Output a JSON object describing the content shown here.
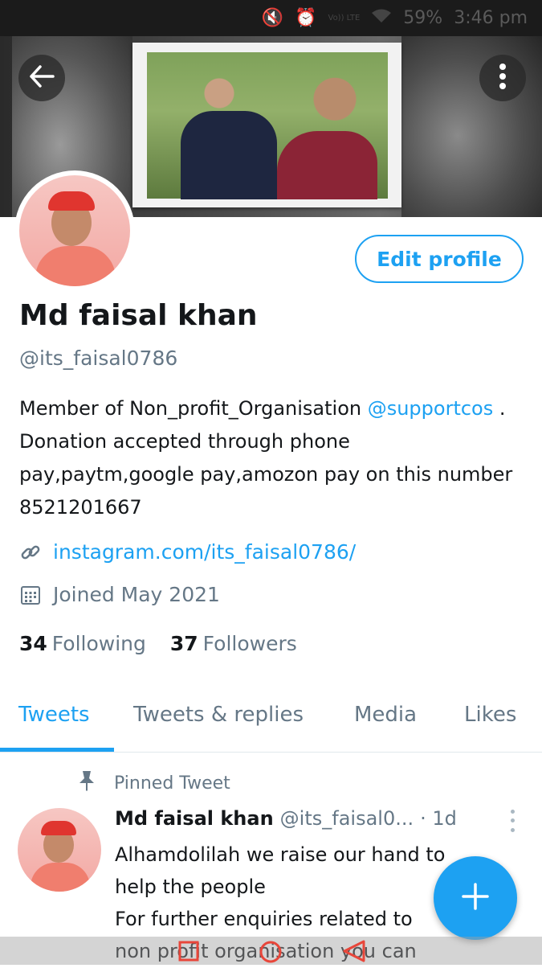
{
  "status_bar": {
    "battery": "59%",
    "time": "3:46 pm",
    "network": "Vo)) LTE"
  },
  "profile": {
    "name": "Md faisal khan",
    "handle": "@its_faisal0786",
    "edit_label": "Edit profile",
    "bio_before": "Member of Non_profit_Organisation ",
    "bio_mention": "@supportcos",
    "bio_after": " . Donation accepted through phone pay,paytm,google pay,amozon pay on this number 8521201667",
    "link": "instagram.com/its_faisal0786/",
    "joined": "Joined May 2021",
    "following_count": "34",
    "following_label": "Following",
    "followers_count": "37",
    "followers_label": "Followers"
  },
  "tabs": [
    {
      "label": "Tweets",
      "active": true
    },
    {
      "label": "Tweets & replies",
      "active": false
    },
    {
      "label": "Media",
      "active": false
    },
    {
      "label": "Likes",
      "active": false
    }
  ],
  "tweet": {
    "pinned_label": "Pinned Tweet",
    "author_name": "Md faisal khan",
    "author_handle": "@its_faisal0...",
    "time": "· 1d",
    "text_lines": [
      "Alhamdolilah we raise our hand to",
      "help the people",
      "For further enquiries related to",
      "non profit organisation you can"
    ]
  },
  "colors": {
    "accent": "#1da1f2",
    "muted": "#657786",
    "text": "#14171a"
  },
  "icons": {
    "back": "arrow-left-icon",
    "more": "more-vertical-icon",
    "link": "link-icon",
    "calendar": "calendar-icon",
    "pin": "pin-icon",
    "compose": "plus-icon"
  }
}
